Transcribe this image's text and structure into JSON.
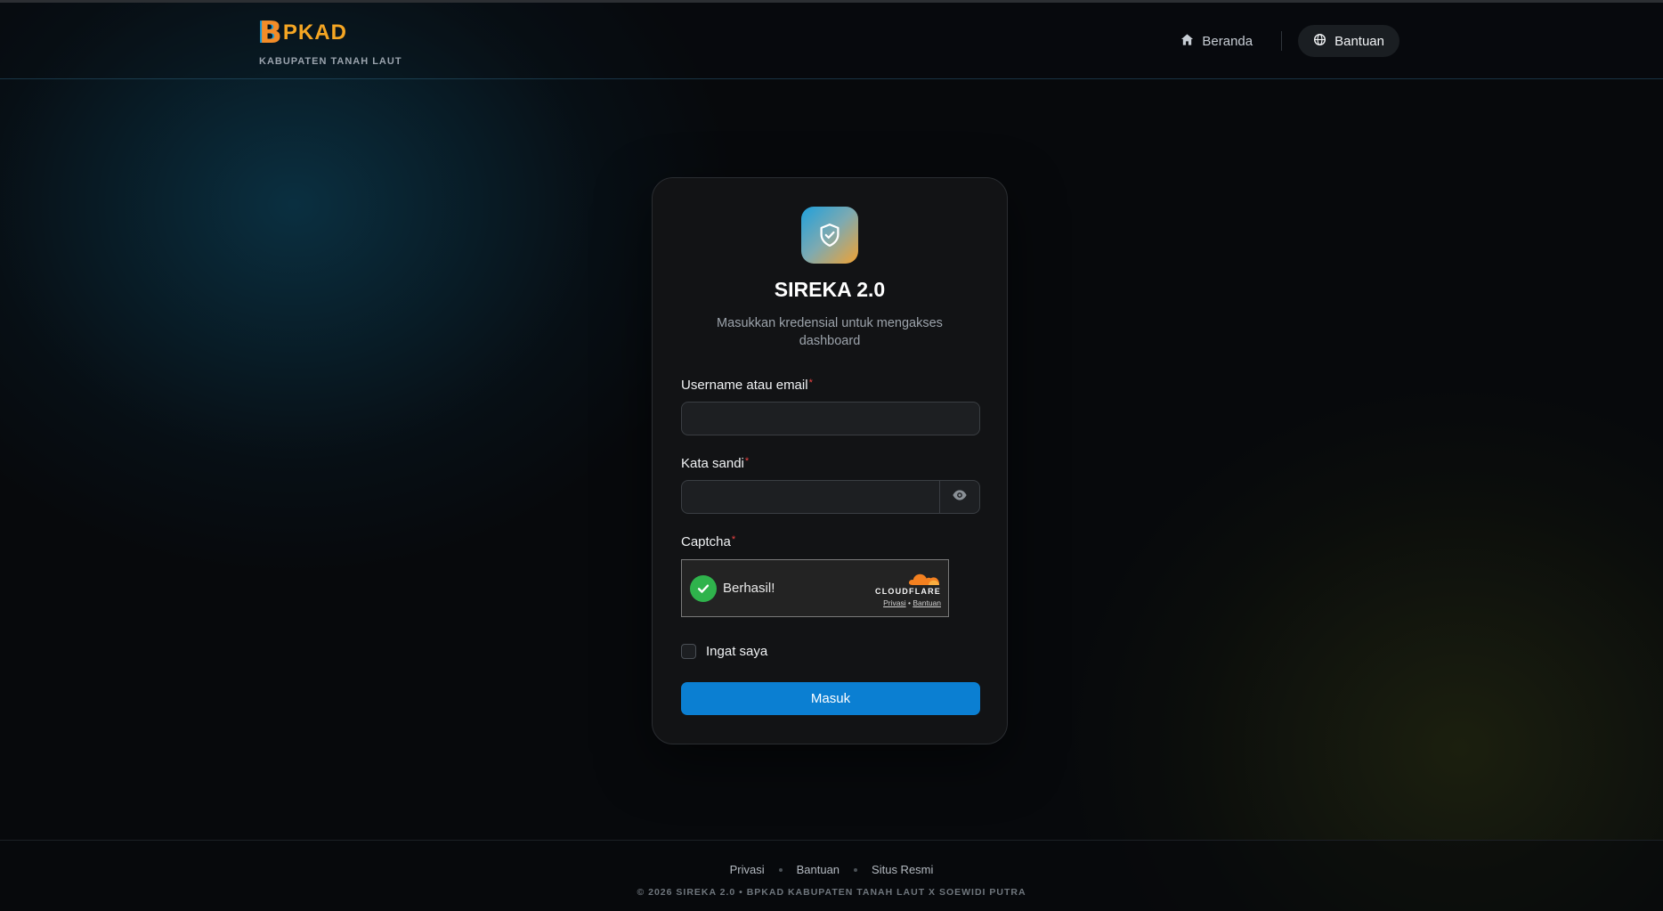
{
  "brand": {
    "logo_letter": "B",
    "logo_text": "PKAD",
    "subtitle": "KABUPATEN TANAH LAUT"
  },
  "nav": {
    "home_label": "Beranda",
    "help_label": "Bantuan"
  },
  "login": {
    "title": "SIREKA 2.0",
    "subtitle": "Masukkan kredensial untuk mengakses dashboard",
    "username_label": "Username atau email",
    "username_value": "",
    "password_label": "Kata sandi",
    "password_value": "",
    "captcha_label": "Captcha",
    "required_mark": "*",
    "remember_label": "Ingat saya",
    "submit_label": "Masuk"
  },
  "captcha": {
    "status": "Berhasil!",
    "provider": "CLOUDFLARE",
    "privacy_link": "Privasi",
    "separator": "•",
    "help_link": "Bantuan"
  },
  "footer": {
    "links": [
      "Privasi",
      "Bantuan",
      "Situs Resmi"
    ],
    "copyright": "© 2026 SIREKA 2.0 • BPKAD KABUPATEN TANAH LAUT X SOEWIDI PUTRA"
  },
  "colors": {
    "accent": "#0b7fd2",
    "logo_orange": "#f5a623",
    "success": "#2fb34c",
    "required": "#ef4444"
  },
  "icons": {
    "home": "home-icon",
    "help": "globe-help-icon",
    "app": "shield-check-icon",
    "toggle_password": "eye-icon",
    "captcha_success": "check-circle-icon",
    "provider": "cloudflare-logo-icon"
  }
}
